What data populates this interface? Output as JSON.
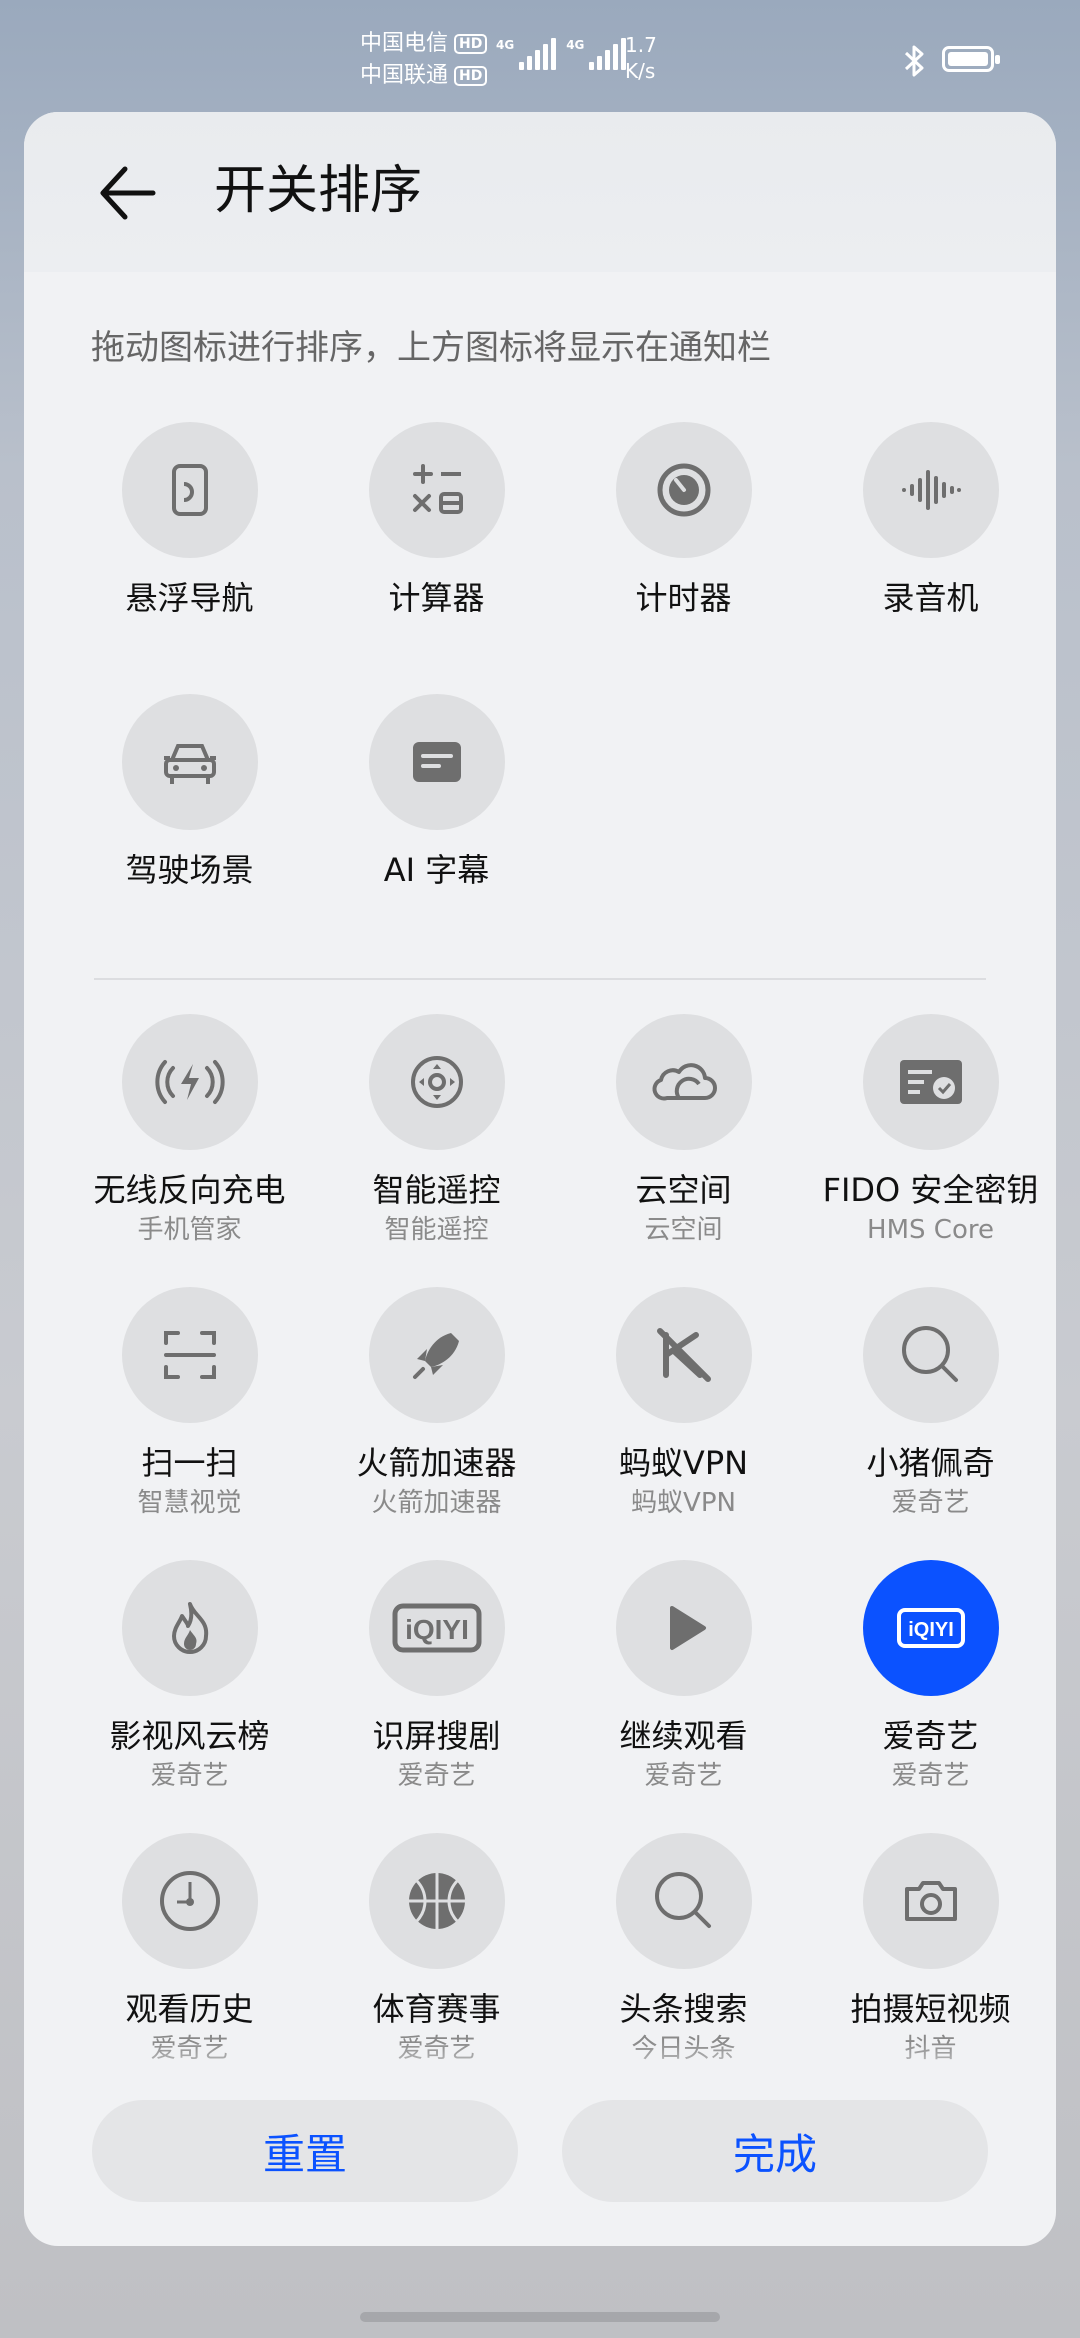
{
  "status": {
    "carrier1": "中国电信",
    "carrier2": "中国联通",
    "hd": "HD",
    "net": "4G",
    "speed_value": "1.7",
    "speed_unit": "K/s"
  },
  "header": {
    "title": "开关排序",
    "subtitle": "拖动图标进行排序，上方图标将显示在通知栏"
  },
  "top_items": [
    {
      "label": "悬浮导航",
      "icon": "floating-nav-icon"
    },
    {
      "label": "计算器",
      "icon": "calculator-icon"
    },
    {
      "label": "计时器",
      "icon": "timer-icon"
    },
    {
      "label": "录音机",
      "icon": "recorder-icon"
    },
    {
      "label": "驾驶场景",
      "icon": "car-icon"
    },
    {
      "label": "AI 字幕",
      "icon": "subtitle-icon"
    }
  ],
  "bottom_items": [
    {
      "label": "无线反向充电",
      "sub": "手机管家",
      "icon": "wireless-charge-icon"
    },
    {
      "label": "智能遥控",
      "sub": "智能遥控",
      "icon": "remote-control-icon"
    },
    {
      "label": "云空间",
      "sub": "云空间",
      "icon": "cloud-icon"
    },
    {
      "label": "FIDO 安全密钥",
      "sub": "HMS Core",
      "icon": "security-key-icon"
    },
    {
      "label": "扫一扫",
      "sub": "智慧视觉",
      "icon": "scan-icon"
    },
    {
      "label": "火箭加速器",
      "sub": "火箭加速器",
      "icon": "rocket-icon"
    },
    {
      "label": "蚂蚁VPN",
      "sub": "蚂蚁VPN",
      "icon": "vpn-icon"
    },
    {
      "label": "小猪佩奇",
      "sub": "爱奇艺",
      "icon": "search-icon"
    },
    {
      "label": "影视风云榜",
      "sub": "爱奇艺",
      "icon": "flame-icon"
    },
    {
      "label": "识屏搜剧",
      "sub": "爱奇艺",
      "icon": "iqiyi-logo-icon"
    },
    {
      "label": "继续观看",
      "sub": "爱奇艺",
      "icon": "play-icon"
    },
    {
      "label": "爱奇艺",
      "sub": "爱奇艺",
      "icon": "iqiyi-app-icon"
    },
    {
      "label": "观看历史",
      "sub": "爱奇艺",
      "icon": "history-icon"
    },
    {
      "label": "体育赛事",
      "sub": "爱奇艺",
      "icon": "basketball-icon"
    },
    {
      "label": "头条搜索",
      "sub": "今日头条",
      "icon": "search-icon"
    },
    {
      "label": "拍摄短视频",
      "sub": "抖音",
      "icon": "camera-icon"
    }
  ],
  "buttons": {
    "reset": "重置",
    "done": "完成"
  },
  "colors": {
    "accent": "#0b52ff",
    "icon_bg": "#dedfe1",
    "icon_fg": "#6e6e6e"
  },
  "iqiyi_text": "iQIYI"
}
